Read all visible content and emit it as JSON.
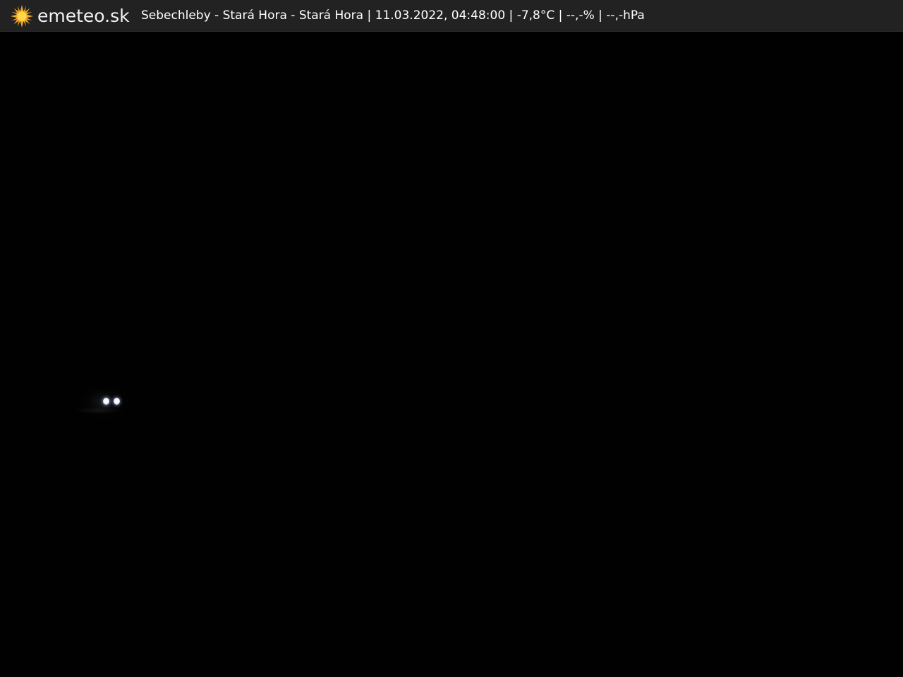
{
  "header": {
    "brand": "emeteo.sk",
    "brand_icon": "sun-icon",
    "location": "Sebechleby - Stará Hora - Stará Hora",
    "datetime": "11.03.2022, 04:48:00",
    "temperature": "-7,8°C",
    "humidity": "--,-%",
    "pressure": "--,-hPa",
    "separator": "|"
  },
  "colors": {
    "header_background": "#222222",
    "header_text": "#ffffff",
    "sun_outer": "#f5a623",
    "sun_inner": "#ffd84a",
    "image_background": "#010101"
  }
}
